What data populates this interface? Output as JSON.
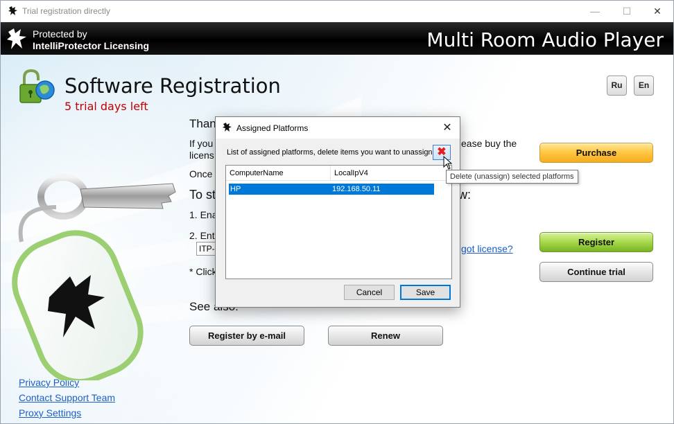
{
  "window": {
    "title": "Trial registration directly",
    "controls": {
      "minimize": "—",
      "maximize": "☐",
      "close": "✕"
    }
  },
  "header": {
    "protected_by": "Protected by",
    "licensing": "IntelliProtector Licensing",
    "product": "Multi Room Audio Player"
  },
  "registration": {
    "title": "Software Registration",
    "trial_days": "5 trial days left",
    "lang_ru": "Ru",
    "lang_en": "En",
    "thanks_fragment": "Than",
    "if_you_fragment": "If you",
    "license_fragment": "licens",
    "buy_fragment": "ease buy the",
    "once_fragment": "Once",
    "to_start_fragment": "To st",
    "below_fragment": "w:",
    "step1": "1. Ena",
    "step2": "2. Ent",
    "key_value": "ITP-",
    "forgot_license": "got license?",
    "click_note": "* Click",
    "see_also": "See also:"
  },
  "buttons": {
    "purchase": "Purchase",
    "register": "Register",
    "continue_trial": "Continue trial",
    "register_email": "Register by e-mail",
    "renew": "Renew"
  },
  "links": {
    "privacy": "Privacy Policy",
    "support": "Contact Support Team",
    "proxy": "Proxy Settings"
  },
  "dialog": {
    "title": "Assigned Platforms",
    "close": "✕",
    "instruction": "List of assigned platforms, delete items you want to unassign",
    "delete_symbol": "✖",
    "columns": [
      "ComputerName",
      "LocalIpV4"
    ],
    "rows": [
      {
        "computer": "HP",
        "ip": "192.168.50.11"
      }
    ],
    "cancel": "Cancel",
    "save": "Save",
    "tooltip": "Delete (unassign) selected platforms"
  },
  "colors": {
    "trial_red": "#c00000",
    "link_blue": "#1a5fc8",
    "selection_blue": "#0078d7",
    "purchase_orange": "#ffc640",
    "register_green": "#a6d84a"
  },
  "icons": {
    "app": "dragon-icon",
    "lock": "lock-globe-icon",
    "delete": "red-x-icon",
    "cursor": "mouse-pointer-icon"
  }
}
